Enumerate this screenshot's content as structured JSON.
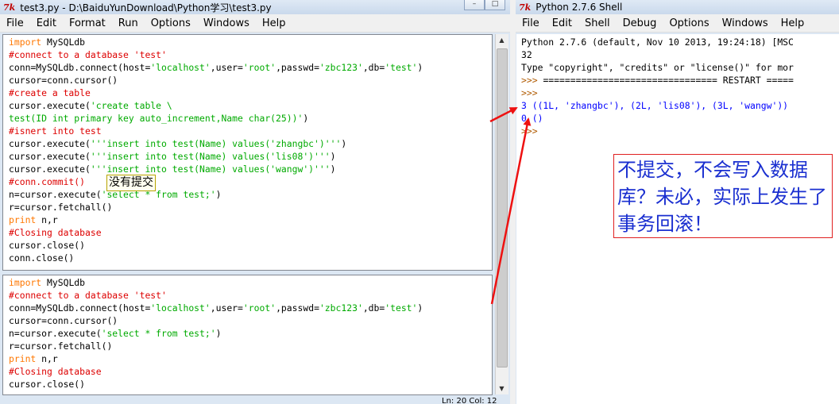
{
  "editor_window": {
    "title": "test3.py - D:\\BaiduYunDownload\\Python学习\\test3.py",
    "menu": [
      "File",
      "Edit",
      "Format",
      "Run",
      "Options",
      "Windows",
      "Help"
    ],
    "status": "Ln: 20  Col: 12",
    "code1": [
      [
        {
          "t": "import",
          "c": "kw"
        },
        {
          "t": " MySQLdb"
        }
      ],
      [
        {
          "t": "#connect to a database 'test'",
          "c": "cm"
        }
      ],
      [
        {
          "t": "conn=MySQLdb.connect(host="
        },
        {
          "t": "'localhost'",
          "c": "st"
        },
        {
          "t": ",user="
        },
        {
          "t": "'root'",
          "c": "st"
        },
        {
          "t": ",passwd="
        },
        {
          "t": "'zbc123'",
          "c": "st"
        },
        {
          "t": ",db="
        },
        {
          "t": "'test'",
          "c": "st"
        },
        {
          "t": ")"
        }
      ],
      [
        {
          "t": "cursor=conn.cursor()"
        }
      ],
      [
        {
          "t": "#create a table",
          "c": "cm"
        }
      ],
      [
        {
          "t": "cursor.execute("
        },
        {
          "t": "'create table \\",
          "c": "st"
        }
      ],
      [
        {
          "t": "test(ID int primary key auto_increment,Name char(25))'",
          "c": "st"
        },
        {
          "t": ")"
        }
      ],
      [
        {
          "t": "#isnert into test",
          "c": "cm"
        }
      ],
      [
        {
          "t": "cursor.execute("
        },
        {
          "t": "'''insert into test(Name) values('zhangbc')'''",
          "c": "st"
        },
        {
          "t": ")"
        }
      ],
      [
        {
          "t": "cursor.execute("
        },
        {
          "t": "'''insert into test(Name) values('lis08')'''",
          "c": "st"
        },
        {
          "t": ")"
        }
      ],
      [
        {
          "t": "cursor.execute("
        },
        {
          "t": "'''insert into test(Name) values('wangw')'''",
          "c": "st"
        },
        {
          "t": ")"
        }
      ],
      [
        {
          "t": "#conn.commit()",
          "c": "cm"
        }
      ],
      [
        {
          "t": "n=cursor.execute("
        },
        {
          "t": "'select * from test;'",
          "c": "st"
        },
        {
          "t": ")"
        }
      ],
      [
        {
          "t": "r=cursor.fetchall()"
        }
      ],
      [
        {
          "t": "print",
          "c": "kw"
        },
        {
          "t": " n,r"
        }
      ],
      [
        {
          "t": "#Closing database",
          "c": "cm"
        }
      ],
      [
        {
          "t": "cursor.close()"
        }
      ],
      [
        {
          "t": "conn.close()"
        }
      ]
    ],
    "code2": [
      [
        {
          "t": "import",
          "c": "kw"
        },
        {
          "t": " MySQLdb"
        }
      ],
      [
        {
          "t": "#connect to a database 'test'",
          "c": "cm"
        }
      ],
      [
        {
          "t": "conn=MySQLdb.connect(host="
        },
        {
          "t": "'localhost'",
          "c": "st"
        },
        {
          "t": ",user="
        },
        {
          "t": "'root'",
          "c": "st"
        },
        {
          "t": ",passwd="
        },
        {
          "t": "'zbc123'",
          "c": "st"
        },
        {
          "t": ",db="
        },
        {
          "t": "'test'",
          "c": "st"
        },
        {
          "t": ")"
        }
      ],
      [
        {
          "t": "cursor=conn.cursor()"
        }
      ],
      [
        {
          "t": "n=cursor.execute("
        },
        {
          "t": "'select * from test;'",
          "c": "st"
        },
        {
          "t": ")"
        }
      ],
      [
        {
          "t": "r=cursor.fetchall()"
        }
      ],
      [
        {
          "t": "print",
          "c": "kw"
        },
        {
          "t": " n,r"
        }
      ],
      [
        {
          "t": "#Closing database",
          "c": "cm"
        }
      ],
      [
        {
          "t": "cursor.close()"
        }
      ]
    ]
  },
  "shell_window": {
    "title": "Python 2.7.6 Shell",
    "menu": [
      "File",
      "Edit",
      "Shell",
      "Debug",
      "Options",
      "Windows",
      "Help"
    ],
    "lines": [
      [
        {
          "t": "Python 2.7.6 (default, Nov 10 2013, 19:24:18) [MSC"
        }
      ],
      [
        {
          "t": "32"
        }
      ],
      [
        {
          "t": "Type \"copyright\", \"credits\" or \"license()\" for mor"
        }
      ],
      [
        {
          "t": ">>> ",
          "c": "prompt"
        },
        {
          "t": "================================ RESTART ====="
        }
      ],
      [
        {
          "t": ">>>",
          "c": "prompt"
        }
      ],
      [
        {
          "t": "3 ((1L, 'zhangbc'), (2L, 'lis08'), (3L, 'wangw'))",
          "c": "out"
        }
      ],
      [
        {
          "t": "0 ()",
          "c": "out"
        }
      ],
      [
        {
          "t": ">>>",
          "c": "prompt"
        }
      ]
    ]
  },
  "annotations": {
    "not_committed": "没有提交",
    "explanation": "不提交，不会写入数据库？未必，实际上发生了事务回滚！"
  },
  "colors": {
    "arrow": "#ee1111",
    "annotation_text": "#1a2fd0",
    "annotation_border": "#e02020"
  },
  "icons": {
    "window_logo": "python-idle-icon"
  }
}
